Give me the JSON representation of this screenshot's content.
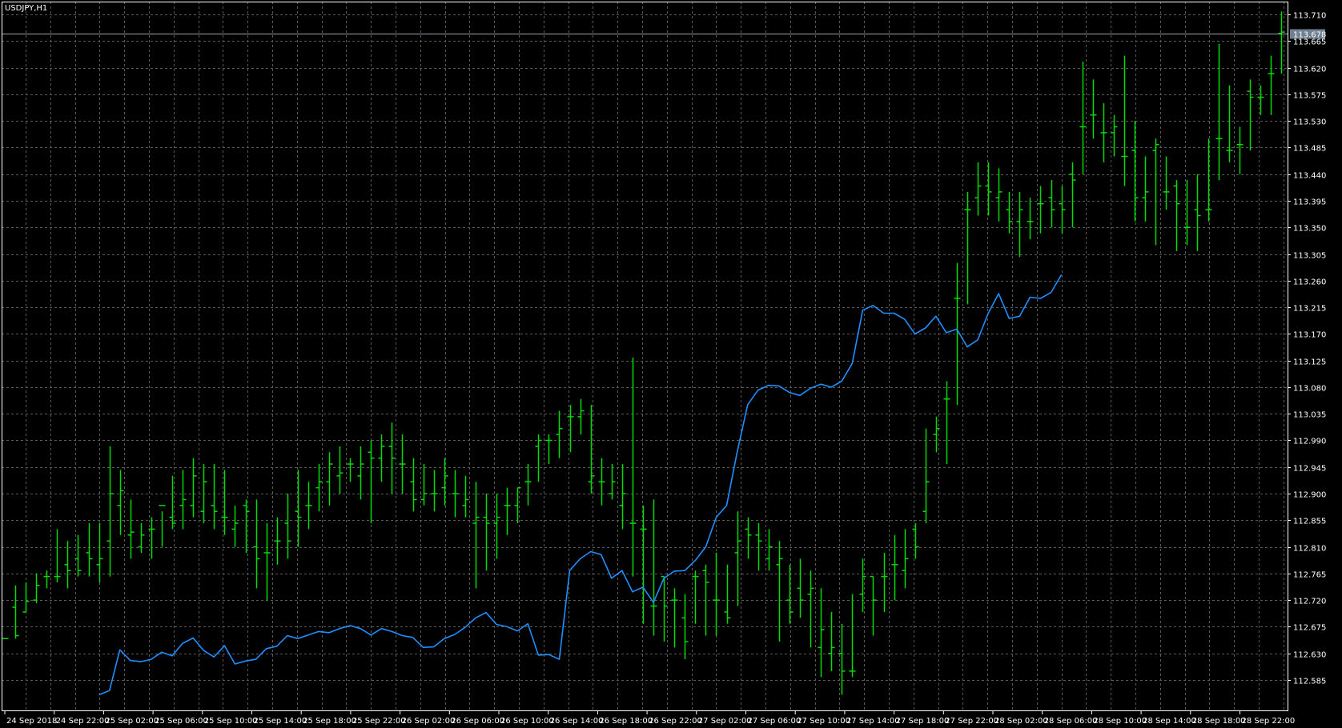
{
  "chart_data": {
    "type": "ohlc",
    "title": "USDJPY,H1",
    "current_price": "113.678",
    "y_ticks": [
      "113.710",
      "113.665",
      "113.620",
      "113.575",
      "113.530",
      "113.485",
      "113.440",
      "113.395",
      "113.350",
      "113.305",
      "113.260",
      "113.215",
      "113.170",
      "113.125",
      "113.080",
      "113.035",
      "112.990",
      "112.945",
      "112.900",
      "112.855",
      "112.810",
      "112.765",
      "112.720",
      "112.675",
      "112.630",
      "112.585"
    ],
    "ylim": [
      112.545,
      113.72
    ],
    "x_ticks": [
      "24 Sep 2018",
      "24 Sep 22:00",
      "25 Sep 02:00",
      "25 Sep 06:00",
      "25 Sep 10:00",
      "25 Sep 14:00",
      "25 Sep 18:00",
      "25 Sep 22:00",
      "26 Sep 02:00",
      "26 Sep 06:00",
      "26 Sep 10:00",
      "26 Sep 14:00",
      "26 Sep 18:00",
      "26 Sep 22:00",
      "27 Sep 02:00",
      "27 Sep 06:00",
      "27 Sep 10:00",
      "27 Sep 14:00",
      "27 Sep 18:00",
      "27 Sep 22:00",
      "28 Sep 02:00",
      "28 Sep 06:00",
      "28 Sep 10:00",
      "28 Sep 14:00",
      "28 Sep 18:00",
      "28 Sep 22:00"
    ],
    "grid": true,
    "colors": {
      "background": "#000000",
      "grid": "#5a5a5a",
      "bars": "#00dd00",
      "ma_line": "#1e90ff",
      "axis": "#ffffff",
      "price_tag": "#708090"
    },
    "ohlc": [
      [
        112.655,
        112.655,
        112.655,
        112.655
      ],
      [
        112.708,
        112.745,
        112.655,
        112.66
      ],
      [
        112.7,
        112.75,
        112.7,
        112.718
      ],
      [
        112.72,
        112.765,
        112.715,
        112.745
      ],
      [
        112.76,
        112.77,
        112.74,
        112.76
      ],
      [
        112.76,
        112.84,
        112.75,
        112.76
      ],
      [
        112.78,
        112.82,
        112.74,
        112.77
      ],
      [
        112.79,
        112.83,
        112.76,
        112.77
      ],
      [
        112.8,
        112.85,
        112.76,
        112.79
      ],
      [
        112.78,
        112.85,
        112.75,
        112.79
      ],
      [
        112.82,
        112.98,
        112.76,
        112.9
      ],
      [
        112.88,
        112.94,
        112.83,
        112.905
      ],
      [
        112.83,
        112.89,
        112.79,
        112.835
      ],
      [
        112.81,
        112.85,
        112.8,
        112.83
      ],
      [
        112.84,
        112.86,
        112.79,
        112.84
      ],
      [
        112.88,
        112.87,
        112.81,
        112.88
      ],
      [
        112.86,
        112.93,
        112.84,
        112.85
      ],
      [
        112.88,
        112.94,
        112.84,
        112.89
      ],
      [
        112.88,
        112.96,
        112.86,
        112.93
      ],
      [
        112.87,
        112.95,
        112.85,
        112.92
      ],
      [
        112.88,
        112.95,
        112.84,
        112.87
      ],
      [
        112.86,
        112.94,
        112.83,
        112.86
      ],
      [
        112.84,
        112.88,
        112.81,
        112.85
      ],
      [
        112.88,
        112.89,
        112.8,
        112.87
      ],
      [
        112.81,
        112.89,
        112.74,
        112.79
      ],
      [
        112.8,
        112.85,
        112.72,
        112.8
      ],
      [
        112.82,
        112.86,
        112.78,
        112.82
      ],
      [
        112.85,
        112.9,
        112.79,
        112.82
      ],
      [
        112.87,
        112.94,
        112.81,
        112.86
      ],
      [
        112.88,
        112.92,
        112.84,
        112.88
      ],
      [
        112.91,
        112.95,
        112.87,
        112.92
      ],
      [
        112.92,
        112.97,
        112.88,
        112.95
      ],
      [
        112.93,
        112.98,
        112.9,
        112.935
      ],
      [
        112.95,
        112.96,
        112.92,
        112.95
      ],
      [
        112.93,
        112.98,
        112.89,
        112.95
      ],
      [
        112.97,
        112.99,
        112.85,
        112.96
      ],
      [
        112.96,
        113.0,
        112.92,
        112.98
      ],
      [
        112.98,
        113.02,
        112.9,
        112.96
      ],
      [
        112.95,
        113.0,
        112.9,
        112.95
      ],
      [
        112.92,
        112.96,
        112.87,
        112.89
      ],
      [
        112.89,
        112.95,
        112.88,
        112.9
      ],
      [
        112.9,
        112.94,
        112.87,
        112.9
      ],
      [
        112.91,
        112.96,
        112.88,
        112.93
      ],
      [
        112.9,
        112.94,
        112.86,
        112.9
      ],
      [
        112.88,
        112.93,
        112.86,
        112.89
      ],
      [
        112.85,
        112.92,
        112.74,
        112.86
      ],
      [
        112.86,
        112.9,
        112.77,
        112.85
      ],
      [
        112.85,
        112.9,
        112.79,
        112.86
      ],
      [
        112.88,
        112.91,
        112.83,
        112.88
      ],
      [
        112.88,
        112.91,
        112.85,
        112.91
      ],
      [
        112.92,
        112.95,
        112.88,
        112.92
      ],
      [
        112.98,
        113.0,
        112.92,
        112.99
      ],
      [
        112.99,
        113.0,
        112.95,
        112.99
      ],
      [
        113.0,
        113.04,
        112.96,
        113.01
      ],
      [
        113.03,
        113.05,
        112.97,
        113.03
      ],
      [
        113.03,
        113.06,
        113.0,
        113.04
      ],
      [
        112.92,
        113.05,
        112.9,
        112.93
      ],
      [
        112.92,
        112.96,
        112.88,
        112.92
      ],
      [
        112.9,
        112.95,
        112.89,
        112.92
      ],
      [
        112.88,
        112.95,
        112.84,
        112.9
      ],
      [
        112.85,
        113.13,
        112.76,
        112.85
      ],
      [
        112.84,
        112.88,
        112.68,
        112.84
      ],
      [
        112.71,
        112.89,
        112.66,
        112.71
      ],
      [
        112.76,
        112.76,
        112.65,
        112.71
      ],
      [
        112.72,
        112.74,
        112.64,
        112.72
      ],
      [
        112.69,
        112.73,
        112.62,
        112.65
      ],
      [
        112.76,
        112.77,
        112.68,
        112.76
      ],
      [
        112.77,
        112.78,
        112.66,
        112.75
      ],
      [
        112.72,
        112.8,
        112.66,
        112.72
      ],
      [
        112.7,
        112.78,
        112.68,
        112.69
      ],
      [
        112.8,
        112.87,
        112.71,
        112.82
      ],
      [
        112.84,
        112.86,
        112.79,
        112.83
      ],
      [
        112.83,
        112.85,
        112.77,
        112.82
      ],
      [
        112.79,
        112.84,
        112.77,
        112.81
      ],
      [
        112.78,
        112.82,
        112.65,
        112.79
      ],
      [
        112.72,
        112.78,
        112.68,
        112.7
      ],
      [
        112.74,
        112.79,
        112.69,
        112.72
      ],
      [
        112.73,
        112.77,
        112.64,
        112.74
      ],
      [
        112.64,
        112.74,
        112.59,
        112.67
      ],
      [
        112.63,
        112.7,
        112.6,
        112.64
      ],
      [
        112.63,
        112.68,
        112.56,
        112.6
      ],
      [
        112.6,
        112.73,
        112.59,
        112.6
      ],
      [
        112.73,
        112.79,
        112.7,
        112.76
      ],
      [
        112.76,
        112.76,
        112.66,
        112.72
      ],
      [
        112.76,
        112.8,
        112.7,
        112.76
      ],
      [
        112.78,
        112.83,
        112.72,
        112.78
      ],
      [
        112.77,
        112.84,
        112.74,
        112.79
      ],
      [
        112.84,
        112.85,
        112.79,
        112.81
      ],
      [
        112.87,
        113.01,
        112.85,
        112.92
      ],
      [
        113.0,
        113.03,
        112.97,
        113.01
      ],
      [
        113.06,
        113.09,
        112.95,
        113.06
      ],
      [
        113.23,
        113.29,
        113.05,
        113.23
      ],
      [
        113.38,
        113.41,
        113.22,
        113.38
      ],
      [
        113.4,
        113.46,
        113.37,
        113.42
      ],
      [
        113.42,
        113.46,
        113.37,
        113.41
      ],
      [
        113.4,
        113.45,
        113.36,
        113.41
      ],
      [
        113.38,
        113.41,
        113.34,
        113.36
      ],
      [
        113.36,
        113.41,
        113.3,
        113.38
      ],
      [
        113.36,
        113.4,
        113.33,
        113.36
      ],
      [
        113.39,
        113.42,
        113.34,
        113.39
      ],
      [
        113.4,
        113.43,
        113.35,
        113.38
      ],
      [
        113.39,
        113.42,
        113.34,
        113.38
      ],
      [
        113.44,
        113.46,
        113.35,
        113.43
      ],
      [
        113.52,
        113.63,
        113.44,
        113.52
      ],
      [
        113.54,
        113.6,
        113.5,
        113.54
      ],
      [
        113.51,
        113.56,
        113.46,
        113.51
      ],
      [
        113.51,
        113.54,
        113.47,
        113.52
      ],
      [
        113.47,
        113.64,
        113.42,
        113.47
      ],
      [
        113.48,
        113.53,
        113.36,
        113.4
      ],
      [
        113.4,
        113.47,
        113.36,
        113.41
      ],
      [
        113.48,
        113.5,
        113.32,
        113.49
      ],
      [
        113.41,
        113.47,
        113.38,
        113.41
      ],
      [
        113.42,
        113.43,
        113.31,
        113.39
      ],
      [
        113.35,
        113.43,
        113.32,
        113.35
      ],
      [
        113.38,
        113.44,
        113.31,
        113.37
      ],
      [
        113.38,
        113.5,
        113.36,
        113.38
      ],
      [
        113.5,
        113.66,
        113.43,
        113.5
      ],
      [
        113.48,
        113.59,
        113.46,
        113.48
      ],
      [
        113.49,
        113.52,
        113.44,
        113.49
      ],
      [
        113.58,
        113.6,
        113.48,
        113.57
      ],
      [
        113.57,
        113.59,
        113.54,
        113.57
      ],
      [
        113.61,
        113.64,
        113.54,
        113.61
      ],
      [
        113.678,
        113.715,
        113.61,
        113.68
      ]
    ],
    "ma": [
      null,
      null,
      null,
      null,
      null,
      null,
      null,
      null,
      null,
      112.56,
      112.567,
      112.636,
      112.618,
      112.616,
      112.62,
      112.632,
      112.626,
      112.647,
      112.656,
      112.635,
      112.624,
      112.643,
      112.612,
      112.617,
      112.62,
      112.638,
      112.642,
      112.66,
      112.655,
      112.661,
      112.667,
      112.665,
      112.672,
      112.677,
      112.672,
      112.661,
      112.672,
      112.667,
      112.66,
      112.657,
      112.64,
      112.641,
      112.655,
      112.662,
      112.674,
      112.69,
      112.699,
      112.679,
      112.675,
      112.668,
      112.68,
      112.627,
      112.628,
      112.62,
      112.77,
      112.79,
      112.802,
      112.797,
      112.757,
      112.77,
      112.734,
      112.742,
      112.716,
      112.757,
      112.769,
      112.77,
      112.787,
      112.81,
      112.86,
      112.88,
      112.97,
      113.05,
      113.075,
      113.083,
      113.082,
      113.071,
      113.066,
      113.078,
      113.085,
      113.08,
      113.09,
      113.12,
      113.21,
      113.218,
      113.205,
      113.205,
      113.195,
      113.17,
      113.18,
      113.2,
      113.172,
      113.178,
      113.148,
      113.16,
      113.205,
      113.238,
      113.196,
      113.2,
      113.232,
      113.23,
      113.24,
      113.27
    ]
  }
}
